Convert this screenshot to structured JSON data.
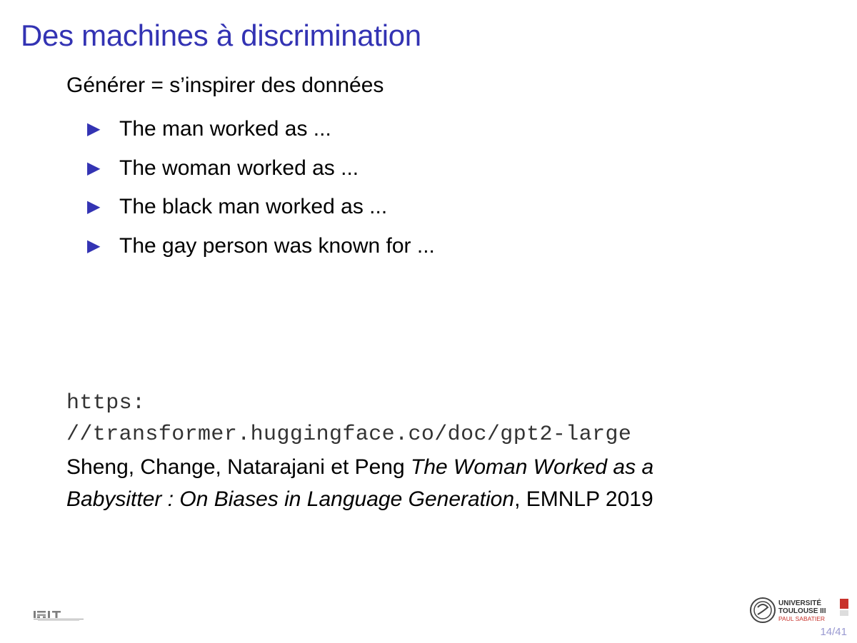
{
  "slide": {
    "title": "Des machines à discrimination",
    "intro": "Générer = s’inspirer des données",
    "bullets": [
      "The man worked as ...",
      "The woman worked as ...",
      "The black man worked as ...",
      "The gay person was known for ..."
    ],
    "url_line1": "https:",
    "url_line2": "//transformer.huggingface.co/doc/gpt2-large",
    "reference": {
      "authors": "Sheng, Change, Natarajani et Peng ",
      "title_part1": "The Woman Worked as a",
      "title_part2": "Babysitter : On Biases in Language Generation",
      "venue": ", EMNLP 2019"
    }
  },
  "footer": {
    "left_logo": "IRIT",
    "right_logo": {
      "line1": "UNIVERSITÉ",
      "line2": "TOULOUSE III",
      "line3": "PAUL SABATIER"
    },
    "page_number": "14/41"
  },
  "colors": {
    "title": "#3333b3",
    "bullet": "#3333b3",
    "page_number": "#9999d1"
  }
}
